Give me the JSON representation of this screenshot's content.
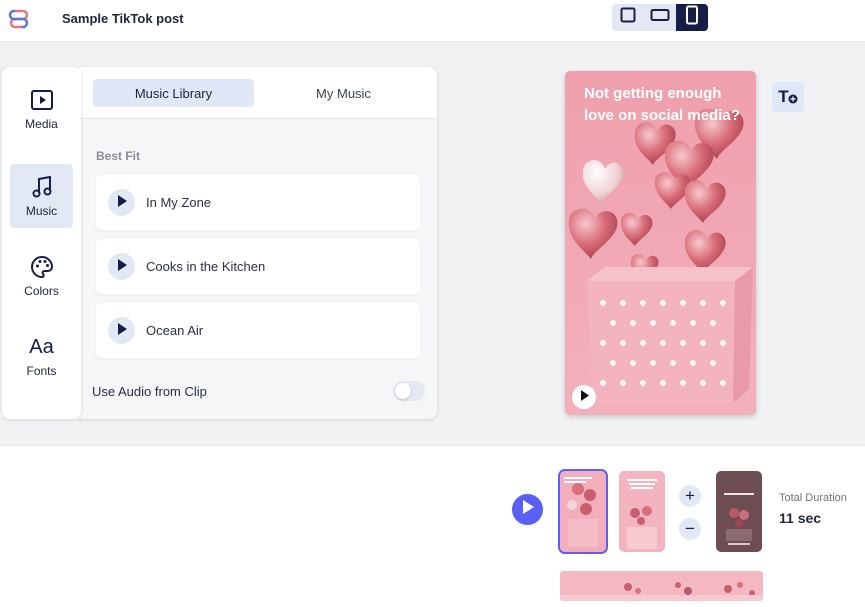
{
  "header": {
    "title": "Sample TikTok post",
    "logo_icon": "brand-logo-icon",
    "aspect_options": [
      {
        "name": "square",
        "icon": "square-aspect-icon",
        "active": false
      },
      {
        "name": "landscape",
        "icon": "landscape-aspect-icon",
        "active": false
      },
      {
        "name": "portrait",
        "icon": "portrait-aspect-icon",
        "active": true
      }
    ]
  },
  "sidebar": {
    "items": [
      {
        "label": "Media",
        "icon": "media-icon",
        "active": false
      },
      {
        "label": "Music",
        "icon": "music-note-icon",
        "active": true
      },
      {
        "label": "Colors",
        "icon": "palette-icon",
        "active": false
      },
      {
        "label": "Fonts",
        "icon": "Aa",
        "active": false
      }
    ]
  },
  "music_panel": {
    "tabs": [
      {
        "label": "Music Library",
        "active": true
      },
      {
        "label": "My Music",
        "active": false
      }
    ],
    "section_label": "Best Fit",
    "tracks": [
      {
        "name": "In My Zone"
      },
      {
        "name": "Cooks in the Kitchen"
      },
      {
        "name": "Ocean Air"
      }
    ],
    "use_audio_label": "Use Audio from Clip",
    "use_audio_enabled": false
  },
  "preview": {
    "caption": "Not getting enough love on social media?"
  },
  "text_tool": {
    "label": "T"
  },
  "timeline": {
    "duration_label": "Total Duration",
    "duration_value": "11 sec",
    "add_label": "+",
    "remove_label": "−"
  },
  "colors": {
    "accent": "#5a5ff5",
    "navy": "#161d47",
    "pink_bg": "#ee9fad"
  }
}
